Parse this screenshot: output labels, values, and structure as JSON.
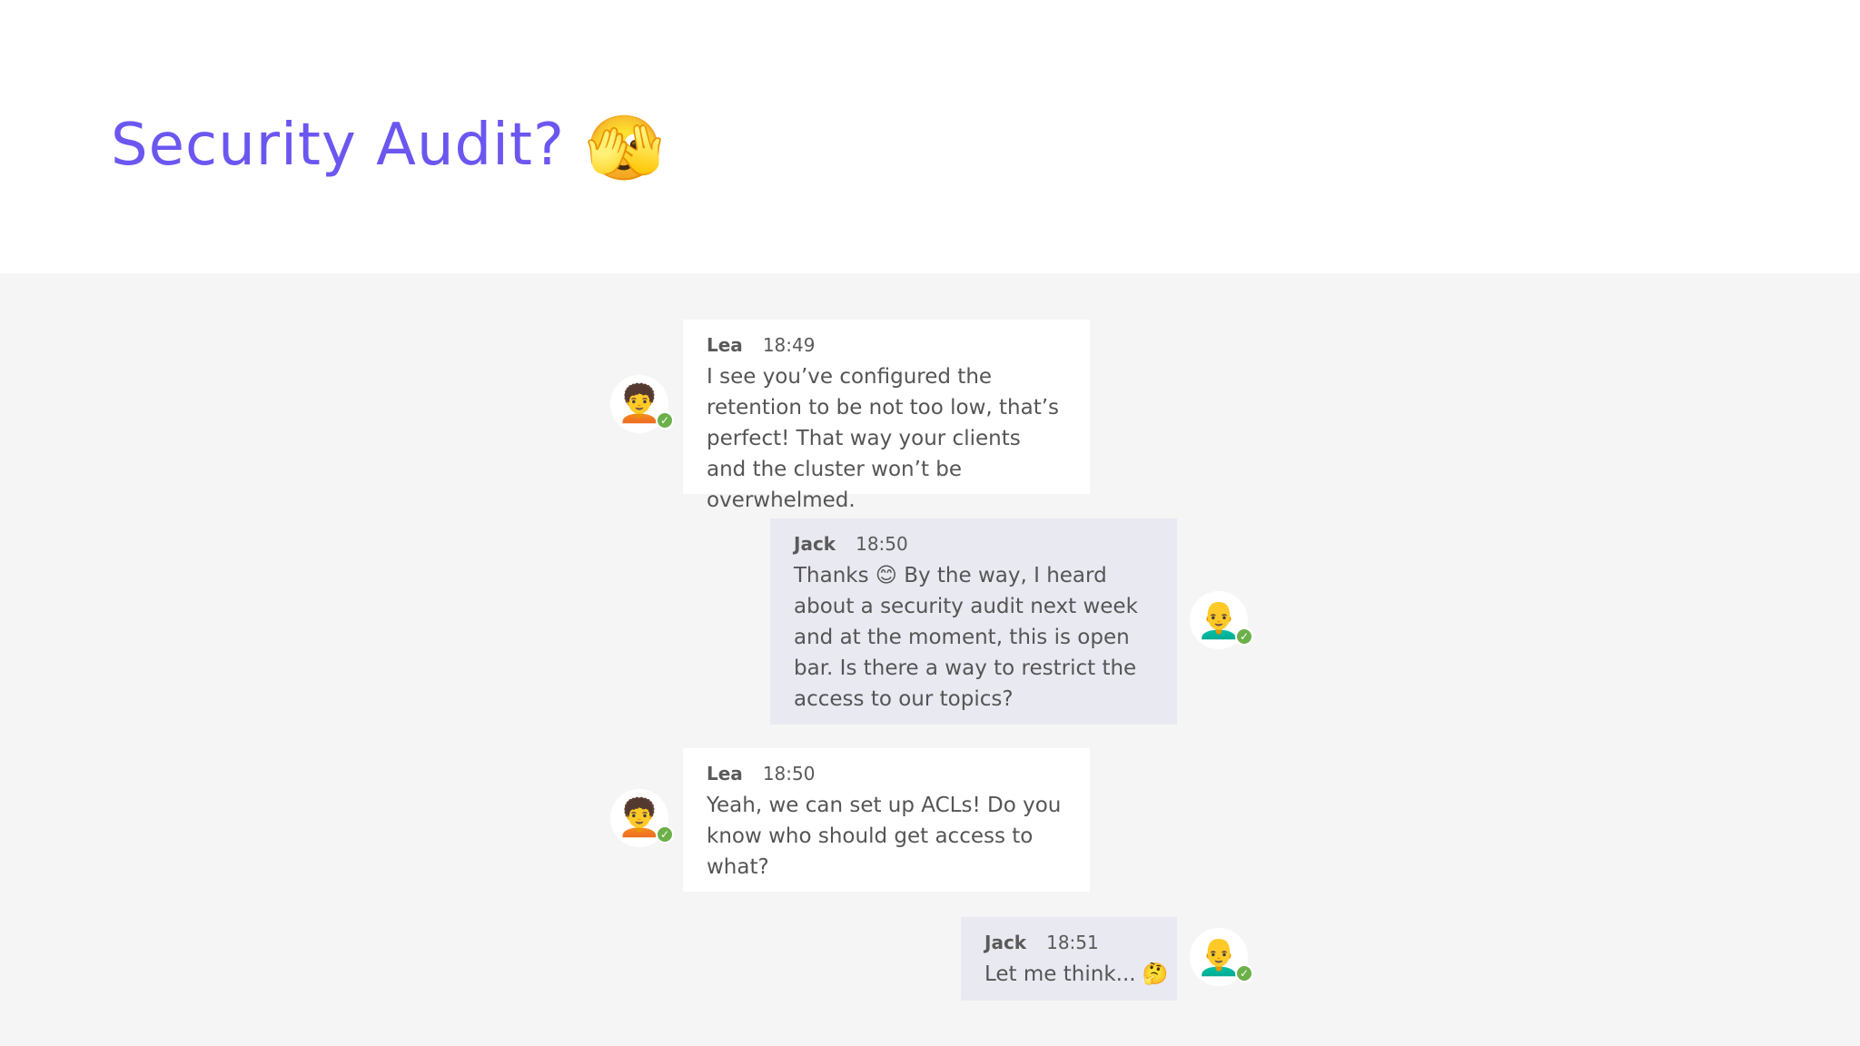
{
  "title": {
    "text": "Security Audit?",
    "emoji": "🫣"
  },
  "messages": [
    {
      "author": "Lea",
      "time": "18:49",
      "text": "I see you’ve configured the retention to be not too low, that’s perfect! That way your clients and the cluster won’t be overwhelmed.",
      "avatar": "🧑‍🦱"
    },
    {
      "author": "Jack",
      "time": "18:50",
      "text": "Thanks 😊 By the way, I heard about a security audit next week and at the moment, this is open bar. Is there a way to restrict the access to our topics?",
      "avatar": "👨‍🦲"
    },
    {
      "author": "Lea",
      "time": "18:50",
      "text": "Yeah, we can set up ACLs! Do you know who should get access to what?",
      "avatar": "🧑‍🦱"
    },
    {
      "author": "Jack",
      "time": "18:51",
      "text": "Let me think... 🤔",
      "avatar": "👨‍🦲"
    }
  ],
  "status": {
    "check_glyph": "✓"
  },
  "colors": {
    "title": "#6b57f0",
    "chat_background": "#f5f5f5",
    "lea_bubble": "#ffffff",
    "jack_bubble": "#e9e9f2",
    "status_online": "#6cb04a"
  }
}
